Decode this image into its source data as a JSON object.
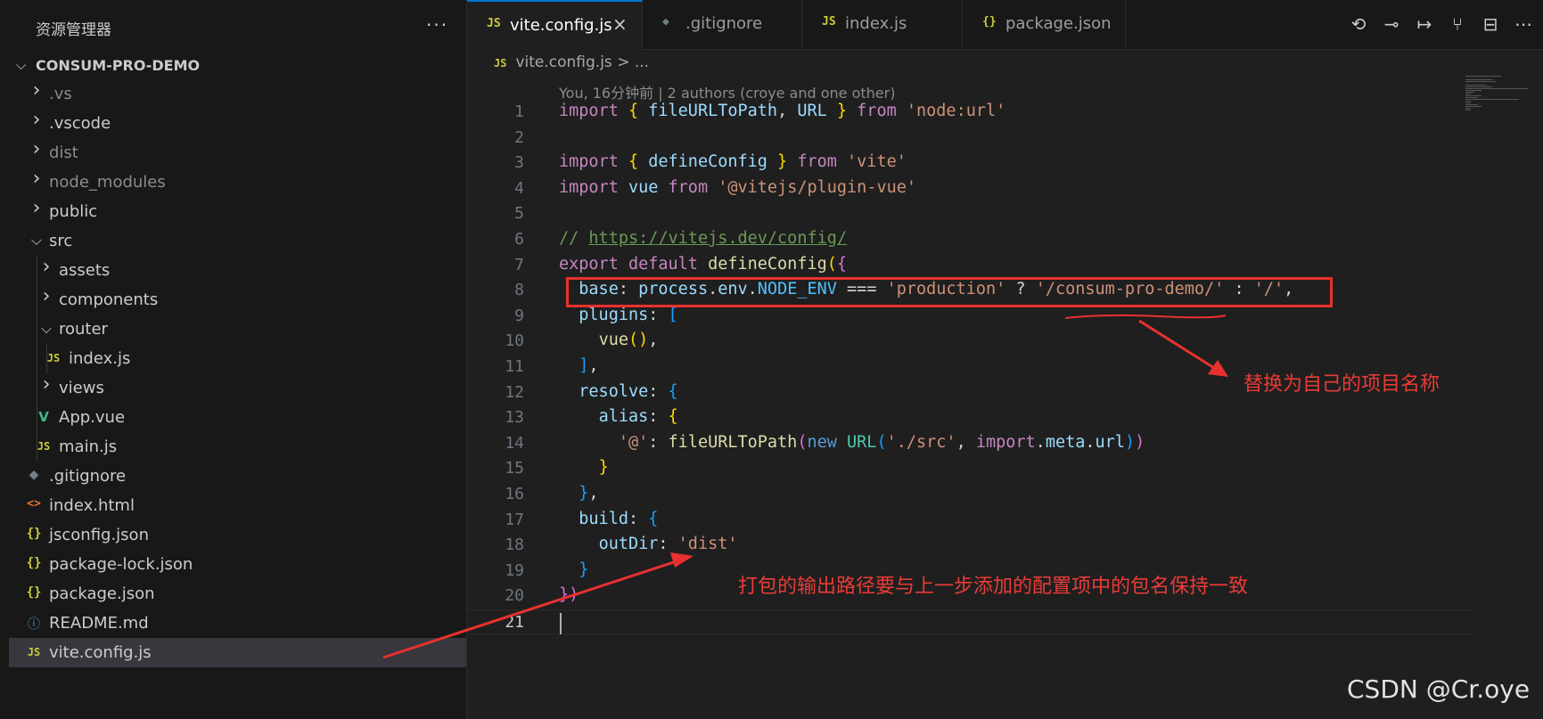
{
  "explorer": {
    "title": "资源管理器",
    "more": "···",
    "root": "CONSUM-PRO-DEMO",
    "items": [
      {
        "label": ".vs",
        "type": "folder",
        "depth": 0,
        "open": false,
        "dim": true
      },
      {
        "label": ".vscode",
        "type": "folder",
        "depth": 0,
        "open": false,
        "dim": false
      },
      {
        "label": "dist",
        "type": "folder",
        "depth": 0,
        "open": false,
        "dim": true
      },
      {
        "label": "node_modules",
        "type": "folder",
        "depth": 0,
        "open": false,
        "dim": true
      },
      {
        "label": "public",
        "type": "folder",
        "depth": 0,
        "open": false,
        "dim": false
      },
      {
        "label": "src",
        "type": "folder",
        "depth": 0,
        "open": true,
        "dim": false
      },
      {
        "label": "assets",
        "type": "folder",
        "depth": 1,
        "open": false,
        "dim": false
      },
      {
        "label": "components",
        "type": "folder",
        "depth": 1,
        "open": false,
        "dim": false
      },
      {
        "label": "router",
        "type": "folder",
        "depth": 1,
        "open": true,
        "dim": false
      },
      {
        "label": "index.js",
        "type": "js",
        "icon": "JS",
        "depth": 2,
        "dim": false
      },
      {
        "label": "views",
        "type": "folder",
        "depth": 1,
        "open": false,
        "dim": false
      },
      {
        "label": "App.vue",
        "type": "vue",
        "icon": "V",
        "depth": 1,
        "dim": false
      },
      {
        "label": "main.js",
        "type": "js",
        "icon": "JS",
        "depth": 1,
        "dim": false
      },
      {
        "label": ".gitignore",
        "type": "git",
        "icon": "◆",
        "depth": 0,
        "dim": false
      },
      {
        "label": "index.html",
        "type": "html",
        "icon": "<>",
        "depth": 0,
        "dim": false
      },
      {
        "label": "jsconfig.json",
        "type": "json",
        "icon": "{}",
        "depth": 0,
        "dim": false
      },
      {
        "label": "package-lock.json",
        "type": "json",
        "icon": "{}",
        "depth": 0,
        "dim": false
      },
      {
        "label": "package.json",
        "type": "json",
        "icon": "{}",
        "depth": 0,
        "dim": false
      },
      {
        "label": "README.md",
        "type": "info",
        "icon": "ⓘ",
        "depth": 0,
        "dim": false
      },
      {
        "label": "vite.config.js",
        "type": "js",
        "icon": "JS",
        "depth": 0,
        "dim": false,
        "selected": true
      }
    ]
  },
  "tabs": [
    {
      "label": "vite.config.js",
      "icon": "JS",
      "icon_color": "#cbcb41",
      "active": true,
      "close": "×"
    },
    {
      "label": ".gitignore",
      "icon": "◆",
      "icon_color": "#6d8086",
      "active": false
    },
    {
      "label": "index.js",
      "icon": "JS",
      "icon_color": "#cbcb41",
      "active": false
    },
    {
      "label": "package.json",
      "icon": "{}",
      "icon_color": "#cbcb41",
      "active": false
    }
  ],
  "toolbar": [
    {
      "name": "git-blame-icon",
      "glyph": "⟲"
    },
    {
      "name": "git-commit-icon",
      "glyph": "⊸"
    },
    {
      "name": "next-change-icon",
      "glyph": "↦"
    },
    {
      "name": "git-graph-icon",
      "glyph": "⑂"
    },
    {
      "name": "split-editor-icon",
      "glyph": "⊟"
    },
    {
      "name": "more-actions-icon",
      "glyph": "⋯"
    }
  ],
  "breadcrumb": {
    "icon": "JS",
    "file": "vite.config.js",
    "separator": ">",
    "rest": "..."
  },
  "blame": "You, 16分钟前 | 2 authors (croye and one other)",
  "code_lines": [
    [
      [
        "k",
        "import"
      ],
      [
        "p",
        " "
      ],
      [
        "br1",
        "{"
      ],
      [
        "p",
        " "
      ],
      [
        "v",
        "fileURLToPath"
      ],
      [
        "p",
        ", "
      ],
      [
        "v",
        "URL"
      ],
      [
        "p",
        " "
      ],
      [
        "br1",
        "}"
      ],
      [
        "p",
        " "
      ],
      [
        "k",
        "from"
      ],
      [
        "p",
        " "
      ],
      [
        "s",
        "'node:url'"
      ]
    ],
    [],
    [
      [
        "k",
        "import"
      ],
      [
        "p",
        " "
      ],
      [
        "br1",
        "{"
      ],
      [
        "p",
        " "
      ],
      [
        "v",
        "defineConfig"
      ],
      [
        "p",
        " "
      ],
      [
        "br1",
        "}"
      ],
      [
        "p",
        " "
      ],
      [
        "k",
        "from"
      ],
      [
        "p",
        " "
      ],
      [
        "s",
        "'vite'"
      ]
    ],
    [
      [
        "k",
        "import"
      ],
      [
        "p",
        " "
      ],
      [
        "v",
        "vue"
      ],
      [
        "p",
        " "
      ],
      [
        "k",
        "from"
      ],
      [
        "p",
        " "
      ],
      [
        "s",
        "'@vitejs/plugin-vue'"
      ]
    ],
    [],
    [
      [
        "c",
        "// "
      ],
      [
        "u",
        "https://vitejs.dev/config/"
      ]
    ],
    [
      [
        "k",
        "export"
      ],
      [
        "p",
        " "
      ],
      [
        "k",
        "default"
      ],
      [
        "p",
        " "
      ],
      [
        "f",
        "defineConfig"
      ],
      [
        "br1",
        "("
      ],
      [
        "br2",
        "{"
      ]
    ],
    [
      [
        "p",
        "  "
      ],
      [
        "v",
        "base"
      ],
      [
        "p",
        ": "
      ],
      [
        "v",
        "process"
      ],
      [
        "p",
        "."
      ],
      [
        "v",
        "env"
      ],
      [
        "p",
        "."
      ],
      [
        "cn",
        "NODE_ENV"
      ],
      [
        "p",
        " === "
      ],
      [
        "s",
        "'production'"
      ],
      [
        "p",
        " ? "
      ],
      [
        "s",
        "'/consum-pro-demo/'"
      ],
      [
        "p",
        " : "
      ],
      [
        "s",
        "'/'"
      ],
      [
        "p",
        ","
      ]
    ],
    [
      [
        "p",
        "  "
      ],
      [
        "v",
        "plugins"
      ],
      [
        "p",
        ": "
      ],
      [
        "br3",
        "["
      ]
    ],
    [
      [
        "p",
        "    "
      ],
      [
        "f",
        "vue"
      ],
      [
        "br1",
        "()"
      ],
      [
        "p",
        ","
      ]
    ],
    [
      [
        "p",
        "  "
      ],
      [
        "br3",
        "]"
      ],
      [
        "p",
        ","
      ]
    ],
    [
      [
        "p",
        "  "
      ],
      [
        "v",
        "resolve"
      ],
      [
        "p",
        ": "
      ],
      [
        "br3",
        "{"
      ]
    ],
    [
      [
        "p",
        "    "
      ],
      [
        "v",
        "alias"
      ],
      [
        "p",
        ": "
      ],
      [
        "br1",
        "{"
      ]
    ],
    [
      [
        "p",
        "      "
      ],
      [
        "s",
        "'@'"
      ],
      [
        "p",
        ": "
      ],
      [
        "f",
        "fileURLToPath"
      ],
      [
        "br2",
        "("
      ],
      [
        "b",
        "new"
      ],
      [
        "p",
        " "
      ],
      [
        "t",
        "URL"
      ],
      [
        "br3",
        "("
      ],
      [
        "s",
        "'./src'"
      ],
      [
        "p",
        ", "
      ],
      [
        "k",
        "import"
      ],
      [
        "p",
        "."
      ],
      [
        "v",
        "meta"
      ],
      [
        "p",
        "."
      ],
      [
        "v",
        "url"
      ],
      [
        "br3",
        ")"
      ],
      [
        "br2",
        ")"
      ]
    ],
    [
      [
        "p",
        "    "
      ],
      [
        "br1",
        "}"
      ]
    ],
    [
      [
        "p",
        "  "
      ],
      [
        "br3",
        "}"
      ],
      [
        "p",
        ","
      ]
    ],
    [
      [
        "p",
        "  "
      ],
      [
        "v",
        "build"
      ],
      [
        "p",
        ": "
      ],
      [
        "br3",
        "{"
      ]
    ],
    [
      [
        "p",
        "    "
      ],
      [
        "v",
        "outDir"
      ],
      [
        "p",
        ": "
      ],
      [
        "s",
        "'dist'"
      ]
    ],
    [
      [
        "p",
        "  "
      ],
      [
        "br3",
        "}"
      ]
    ],
    [
      [
        "br2",
        "})"
      ]
    ],
    []
  ],
  "current_line": 21,
  "annotations": {
    "top": "替换为自己的项目名称",
    "bottom": "打包的输出路径要与上一步添加的配置项中的包名保持一致",
    "color": "#ea3b35"
  },
  "watermark": "CSDN @Cr.oye"
}
